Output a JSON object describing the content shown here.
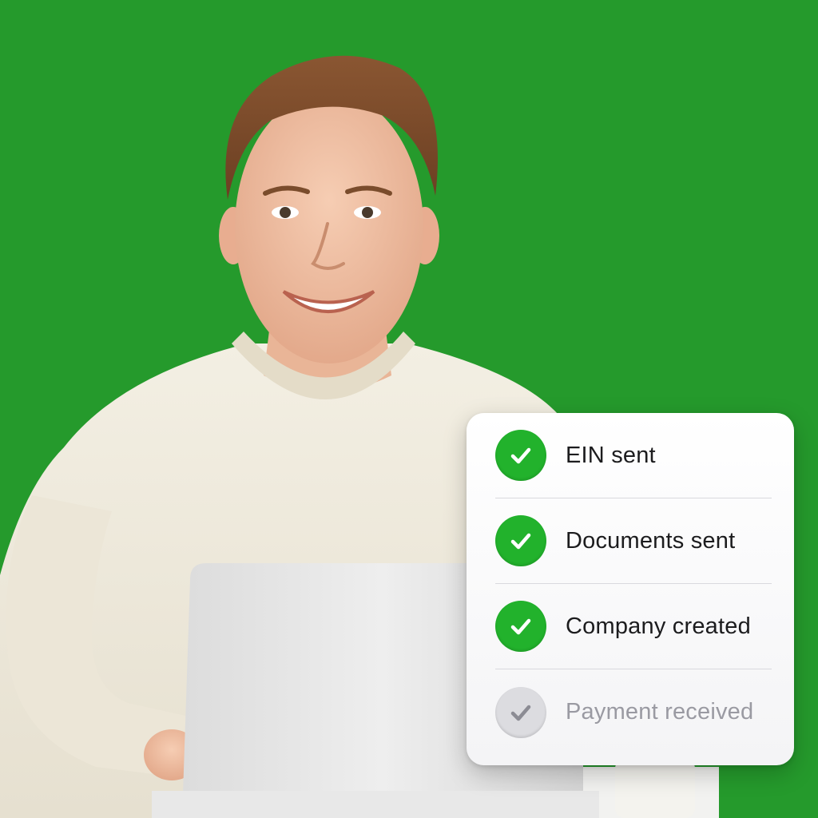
{
  "colors": {
    "background": "#259a2c",
    "check_done": "#22b22c",
    "check_pending": "#dcdce0",
    "label_done": "#1c1c1e",
    "label_pending": "#9a9aa2"
  },
  "status_card": {
    "items": [
      {
        "label": "EIN sent",
        "state": "done",
        "icon": "check-icon"
      },
      {
        "label": "Documents sent",
        "state": "done",
        "icon": "check-icon"
      },
      {
        "label": "Company created",
        "state": "done",
        "icon": "check-icon"
      },
      {
        "label": "Payment received",
        "state": "pending",
        "icon": "check-icon"
      }
    ]
  }
}
